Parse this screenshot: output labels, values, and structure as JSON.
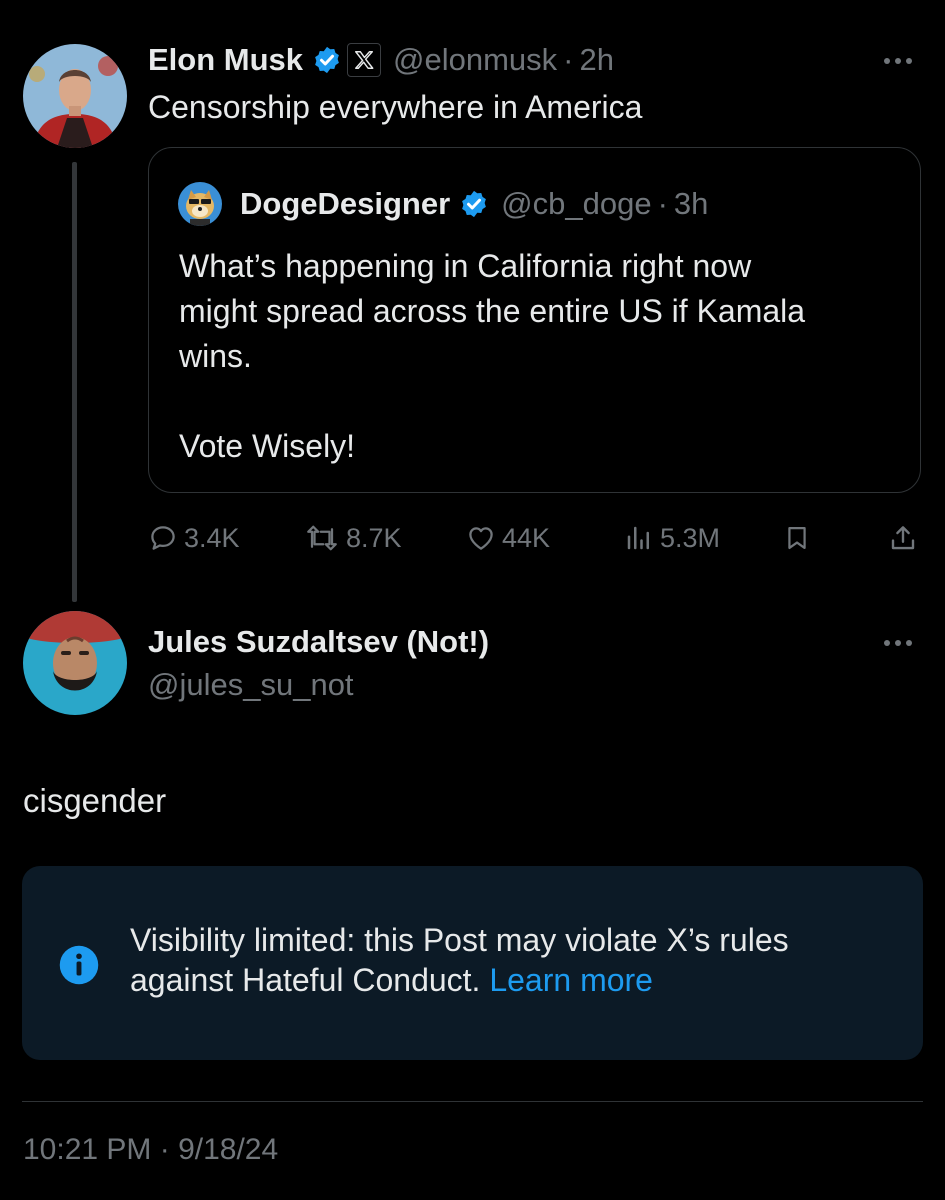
{
  "main_post": {
    "author_name": "Elon Musk",
    "handle": "@elonmusk",
    "separator": "·",
    "time": "2h",
    "text": "Censorship everywhere in America",
    "quoted_post": {
      "author_name": "DogeDesigner",
      "handle": "@cb_doge",
      "separator": "·",
      "time": "3h",
      "text_line1": "What’s happening in California right now",
      "text_line2": "might spread across the entire US if Kamala",
      "text_line3": "wins.",
      "text_line4": "Vote Wisely!"
    },
    "actions": {
      "replies": "3.4K",
      "reposts": "8.7K",
      "likes": "44K",
      "views": "5.3M"
    }
  },
  "reply_post": {
    "author_name": "Jules Suzdaltsev (Not!)",
    "handle": "@jules_su_not",
    "text": "cisgender",
    "notice": {
      "line1": "Visibility limited: this Post may violate X’s rules",
      "line2": "against Hateful Conduct.",
      "link": "Learn more"
    },
    "timestamp": "10:21 PM · 9/18/24"
  },
  "colors": {
    "background": "#000000",
    "text_primary": "#e7e9ea",
    "text_secondary": "#71767b",
    "accent": "#1d9bf0",
    "notice_background": "#0c1a26",
    "border": "#2f3336"
  },
  "icons": {
    "verified": "verified-badge-icon",
    "affiliate": "x-logo-icon",
    "more": "more-dots-icon",
    "reply": "reply-icon",
    "repost": "repost-icon",
    "like": "heart-icon",
    "views": "views-chart-icon",
    "bookmark": "bookmark-icon",
    "share": "share-icon",
    "info": "info-icon"
  }
}
